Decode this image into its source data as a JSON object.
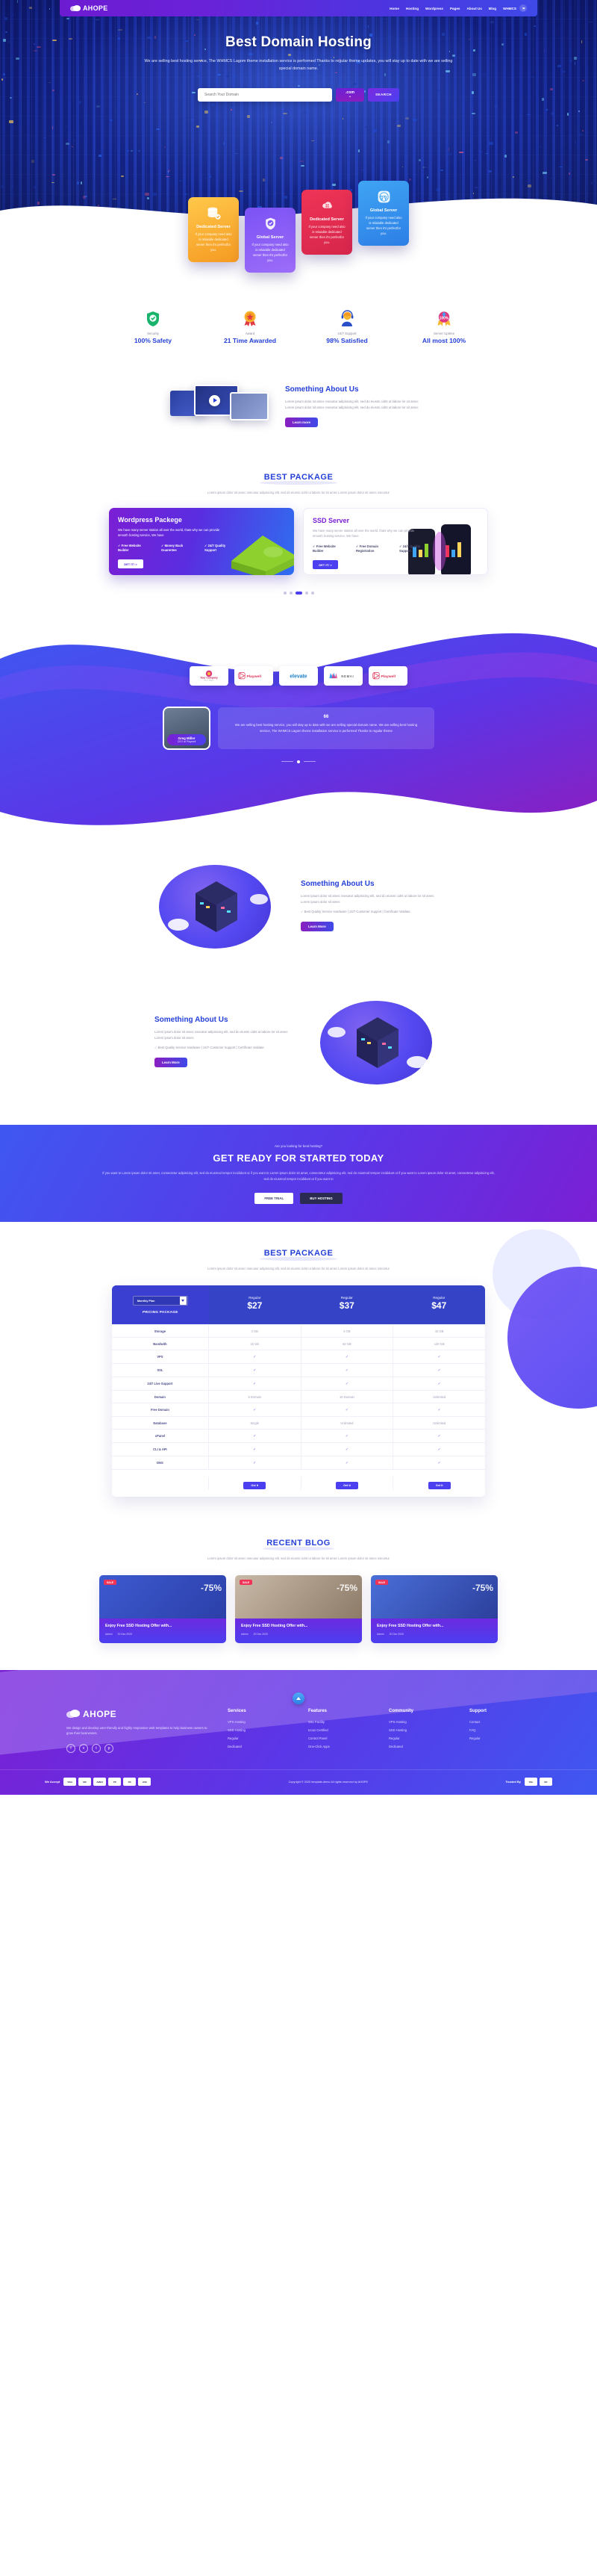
{
  "brand": {
    "name": "AHOPE",
    "logo_icon": "cloud-logo-icon"
  },
  "nav": {
    "items": [
      {
        "label": "Home"
      },
      {
        "label": "Hosting"
      },
      {
        "label": "Wordpress"
      },
      {
        "label": "Pages"
      },
      {
        "label": "About Us"
      },
      {
        "label": "Blog"
      },
      {
        "label": "WHMCS"
      }
    ],
    "cart_icon": "cart-icon"
  },
  "hero": {
    "title": "Best Domain Hosting",
    "subtitle": "We are selling best hosting service, The WHMCS Lagom theme installation service is performed Thanks to regular theme updates, you will stay up to date with we are selling special domain name.",
    "search": {
      "placeholder": "Search Your Domain",
      "value": "",
      "tld": ".com",
      "button": "SEARCH"
    }
  },
  "feature_cards": [
    {
      "icon": "database-icon",
      "title": "Dedicated Server",
      "text": "If your company need also is relaiable dedicated server then it's perfectfor you.",
      "color": "#f5a623"
    },
    {
      "icon": "shield-check-icon",
      "title": "Global Server",
      "text": "If your company need also is relaiable dedicated server then it's perfectfor you.",
      "color": "#7b52f5"
    },
    {
      "icon": "cloud-server-icon",
      "title": "Dedicated Server",
      "text": "If your company need also is relaiable dedicated server then it's perfectfor you.",
      "color": "#ef3457"
    },
    {
      "icon": "wordpress-icon",
      "title": "Global Server",
      "text": "If your company need also is relaiable dedicated server then it's perfectfor you.",
      "color": "#3fa4f3"
    }
  ],
  "stats": [
    {
      "icon": "green-shield-icon",
      "label": "Security",
      "value": "100% Safety"
    },
    {
      "icon": "award-badge-icon",
      "label": "Award",
      "value": "21 Time Awarded"
    },
    {
      "icon": "headset-support-icon",
      "label": "24/7 Support",
      "value": "98% Satisfied"
    },
    {
      "icon": "uptime-badge-icon",
      "label": "Server Uptime",
      "value": "All most 100%"
    }
  ],
  "about1": {
    "heading": "Something About Us",
    "text": "Lorem ipsum dolor sit amec nsecatur adipisicing elit, sed do eiusmi cidnt ut labore lor sit amec Lorem ipsum dolor sit amec nsecetur adipisicing elit, sed do eiusmi cidnt ut labore lor sit amec",
    "button": "Learn more",
    "play_icon": "play-button-icon"
  },
  "best_package": {
    "heading": "BEST PACKAGE",
    "subtext": "Lorem ipsum dolor sit amec nsecatur adipisicing elit, sed do eiusmi cidnt ut labore lor sit amec Lorem ipsum dolor sit amec nsecetur",
    "cards": [
      {
        "title": "Wordpress Packege",
        "desc": "We have many server station all over the world, thats why we can provide smooth hosting service, We have",
        "features": [
          "Free Website Builder",
          "Money Back Guarentee",
          "24/7 Quality Support"
        ],
        "button": "GET IT! >"
      },
      {
        "title": "SSD Server",
        "desc": "We have many server station all over the world, thats why we can provide smooth hosting service, We have",
        "features": [
          "Free Website Builder",
          "Free Domain Registration",
          "24/7 Quality Support"
        ],
        "button": "GET IT! >"
      }
    ],
    "dots": 5
  },
  "partners": [
    {
      "name": "Your Company"
    },
    {
      "name": "Playwell"
    },
    {
      "name": "elevate"
    },
    {
      "name": "NEMAI"
    },
    {
      "name": "Playwell"
    }
  ],
  "testimonial": {
    "quote_mark": "66",
    "text": "We are selling best hosting service, you will stay up to date with we are selling special domain name. We are selling best hosting service, The WHMCS Lagom theme installation service is performed Thanks to regular theme",
    "author": "Greg Miller",
    "role": "CEO at Playwell"
  },
  "about2": {
    "heading": "Something About Us",
    "text": "Lorem ipsum dolor sit amec nsecatur adipisicing elit, sed do eiusmi cidnt ut labore lor sit amec Lorem ipsum dolor sit amec",
    "bullet": "✓ Best Quality Service Hardware | 24/7 Customer Support | Certificate Validate",
    "button": "Learn More"
  },
  "about3": {
    "heading": "Something About Us",
    "text": "Lorem ipsum dolor sit amec nsecatur adipisicing elit, sed do eiusmi cidnt ut labore lor sit amec Lorem ipsum dolor sit amec",
    "bullet": "✓ Best Quality Service Hardware | 24/7 Customer Support | Certificate Validate",
    "button": "Learn More"
  },
  "cta": {
    "pre": "Are you looking for best hosting?",
    "heading": "GET READY FOR STARTED TODAY",
    "text": "If you want to Lorem ipsum dolor sit amet, consectetur adipisicing elit, sed do eiusmod tempor incididunt ut if you want to Lorem ipsum dolor sit amet, consectetur adipisicing elit, sed do eiusmod tempor incididunt ut if you want to Lorem ipsum dolor sit amet, consectetur adipisicing elit, sed do eiusmod tempor incididunt ut if you want to",
    "btn_primary": "FREE TRIAL",
    "btn_secondary": "BUY HOSTING"
  },
  "pricing": {
    "heading": "BEST PACKAGE",
    "subtext": "Lorem ipsum dolor sit amec nsecatur adipisicing elit, sed do eiusmi cidnt ut labore lor sit amec Lorem ipsum dolor sit amec nsecetur",
    "plan_select": "Monthly Plan",
    "package_label": "PRICING PACKAGE",
    "plans": [
      {
        "name": "Regular",
        "price": "$27",
        "button": "Get It"
      },
      {
        "name": "Regular",
        "price": "$37",
        "button": "Get It"
      },
      {
        "name": "Regular",
        "price": "$47",
        "button": "Get It"
      }
    ],
    "rows": [
      {
        "feature": "Storage",
        "values": [
          "3 GB",
          "5 GB",
          "15 GB"
        ]
      },
      {
        "feature": "Bandwith",
        "values": [
          "15 GB",
          "50 GB",
          "120 GB"
        ]
      },
      {
        "feature": "VPS",
        "values": [
          "✓",
          "✓",
          "✓"
        ]
      },
      {
        "feature": "SSL",
        "values": [
          "✓",
          "✓",
          "✓"
        ]
      },
      {
        "feature": "24/7 Live Support",
        "values": [
          "✓",
          "✓",
          "✓"
        ]
      },
      {
        "feature": "Domain",
        "values": [
          "5 Domain",
          "10 Domain",
          "Unlimited"
        ]
      },
      {
        "feature": "Free Domain",
        "values": [
          "✓",
          "✓",
          "✓"
        ]
      },
      {
        "feature": "Database",
        "values": [
          "Single",
          "Unlimited",
          "Unlimited"
        ]
      },
      {
        "feature": "cPanel",
        "values": [
          "✓",
          "✓",
          "✓"
        ]
      },
      {
        "feature": "CLI & API",
        "values": [
          "✓",
          "✓",
          "✓"
        ]
      },
      {
        "feature": "DNS",
        "values": [
          "✓",
          "✓",
          "✓"
        ]
      }
    ]
  },
  "blog": {
    "heading": "RECENT BLOG",
    "subtext": "Lorem ipsum dolor sit amec nsecatur adipisicing elit, sed do eiusmi cidnt ut labore lor sit amec Lorem ipsum dolor sit amec nsecetur",
    "posts": [
      {
        "badge": "SALE",
        "off": "-75%",
        "title": "Enjoy Free SSD Hosting Offer with...",
        "meta": [
          "Admin",
          "20 Dec 2020"
        ]
      },
      {
        "badge": "SALE",
        "off": "-75%",
        "title": "Enjoy Free SSD Hosting Offer with...",
        "meta": [
          "Admin",
          "20 Dec 2020"
        ]
      },
      {
        "badge": "SALE",
        "off": "-75%",
        "title": "Enjoy Free SSD Hosting Offer with...",
        "meta": [
          "Admin",
          "20 Dec 2020"
        ]
      }
    ]
  },
  "footer": {
    "brand": "AHOPE",
    "about": "We design and develop user-friendly and highly responsive web templates to help business owners to grow their businesses.",
    "socials": [
      {
        "name": "facebook-icon",
        "glyph": "f"
      },
      {
        "name": "vimeo-icon",
        "glyph": "v"
      },
      {
        "name": "twitter-icon",
        "glyph": "t"
      },
      {
        "name": "pinterest-icon",
        "glyph": "p"
      }
    ],
    "columns": [
      {
        "title": "Services",
        "links": [
          "VPS Hosting",
          "SSD Hosting",
          "Regular",
          "Dedicated"
        ]
      },
      {
        "title": "Features",
        "links": [
          "SSL Facility",
          "Iccan Certified",
          "Control Panel",
          "One-Click Apps"
        ]
      },
      {
        "title": "Community",
        "links": [
          "VPS Hosting",
          "SSD Hosting",
          "Regular",
          "Dedicated"
        ]
      },
      {
        "title": "Support",
        "links": [
          "Contact",
          "FAQ",
          "Regular"
        ]
      }
    ],
    "accept_label": "We Accept",
    "trusted_label": "Trusted By",
    "payments": [
      "VISA",
      "MC",
      "AMEX",
      "PP",
      "DC",
      "JCB"
    ],
    "trusted": [
      "SSL",
      "NC"
    ],
    "copyright": "Copyright © 2020 template-demo All rights reserved by AHOPE",
    "scroll_top_icon": "scroll-to-top-icon"
  }
}
